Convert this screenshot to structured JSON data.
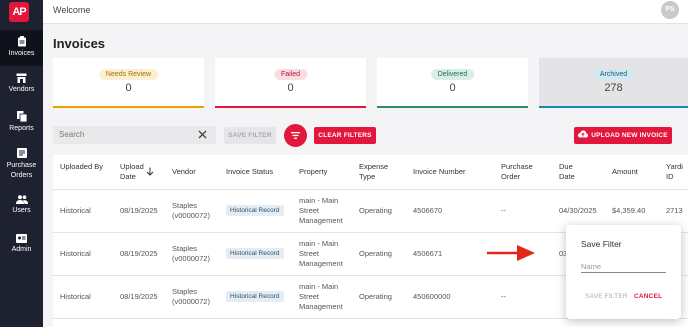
{
  "sidebar": {
    "logo": "AP",
    "items": [
      {
        "label": "Invoices",
        "icon": "clipboard-icon"
      },
      {
        "label": "Vendors",
        "icon": "store-icon"
      },
      {
        "label": "Reports",
        "icon": "files-icon"
      },
      {
        "label": "Purchase Orders",
        "icon": "order-list-icon"
      },
      {
        "label": "Users",
        "icon": "users-icon"
      },
      {
        "label": "Admin",
        "icon": "admin-icon"
      }
    ]
  },
  "topbar": {
    "welcome": "Welcome",
    "avatar_initials": "PS"
  },
  "page": {
    "title": "Invoices"
  },
  "status_cards": [
    {
      "label": "Needs Review",
      "count": "0",
      "color": "#e8a100",
      "pill_bg": "#fdf0d2",
      "pill_fg": "#a36f00"
    },
    {
      "label": "Failed",
      "count": "0",
      "color": "#e3173d",
      "pill_bg": "#fadde2",
      "pill_fg": "#b0142f"
    },
    {
      "label": "Delivered",
      "count": "0",
      "color": "#2e8b6e",
      "pill_bg": "#d9efe6",
      "pill_fg": "#1f6b53"
    },
    {
      "label": "Archived",
      "count": "278",
      "color": "#1e88a8",
      "pill_bg": "#d3e9f1",
      "pill_fg": "#1b5d74",
      "selected": true
    }
  ],
  "toolbar": {
    "search_placeholder": "Search",
    "save_filter": "SAVE FILTER",
    "clear_filters": "CLEAR FILTERS",
    "upload": "UPLOAD NEW INVOICE"
  },
  "table": {
    "columns": [
      "Uploaded By",
      "Upload Date",
      "Vendor",
      "Invoice Status",
      "Property",
      "Expense Type",
      "Invoice Number",
      "Purchase Order",
      "Due Date",
      "Amount",
      "Yardi ID"
    ],
    "rows": [
      {
        "uploaded_by": "Historical",
        "upload_date": "08/19/2025",
        "vendor": "Staples (v0000072)",
        "status": "Historical Record",
        "property": "main - Main Street Management",
        "expense_type": "Operating",
        "invoice_number": "4506670",
        "purchase_order": "--",
        "due_date": "04/30/2025",
        "amount": "$4,359.40",
        "yardi_id": "2713"
      },
      {
        "uploaded_by": "Historical",
        "upload_date": "08/19/2025",
        "vendor": "Staples (v0000072)",
        "status": "Historical Record",
        "property": "main - Main Street Management",
        "expense_type": "Operating",
        "invoice_number": "4506671",
        "purchase_order": "--",
        "due_date": "03",
        "amount": "",
        "yardi_id": ""
      },
      {
        "uploaded_by": "Historical",
        "upload_date": "08/19/2025",
        "vendor": "Staples (v0000072)",
        "status": "Historical Record",
        "property": "main - Main Street Management",
        "expense_type": "Operating",
        "invoice_number": "450600000",
        "purchase_order": "--",
        "due_date": "",
        "amount": "",
        "yardi_id": ""
      }
    ]
  },
  "save_filter_popup": {
    "title": "Save Filter",
    "name_placeholder": "Name",
    "save_button": "SAVE FILTER",
    "cancel_button": "CANCEL"
  },
  "colors": {
    "brand": "#e3173d",
    "sidebar": "#1e2230"
  }
}
